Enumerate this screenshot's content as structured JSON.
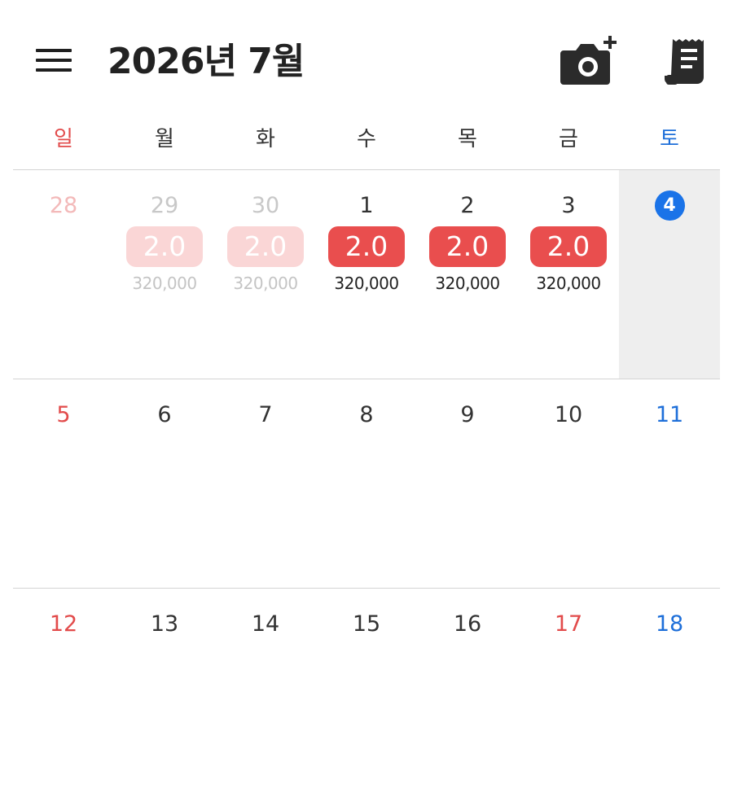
{
  "header": {
    "title": "2026년 7월",
    "icons": {
      "menu": "hamburger-menu-icon",
      "camera": "camera-add-icon",
      "receipt": "receipt-icon"
    }
  },
  "colors": {
    "sunday": "#e24b4b",
    "saturday": "#1e6fd9",
    "badge": "#e94e4e",
    "badge_faded": "#fad6d6",
    "today": "#1a73e8"
  },
  "weekdays": [
    "일",
    "월",
    "화",
    "수",
    "목",
    "금",
    "토"
  ],
  "weeks": [
    [
      {
        "date": "28",
        "other": true
      },
      {
        "date": "29",
        "other": true,
        "badge": "2.0",
        "amount": "320,000"
      },
      {
        "date": "30",
        "other": true,
        "badge": "2.0",
        "amount": "320,000"
      },
      {
        "date": "1",
        "badge": "2.0",
        "amount": "320,000"
      },
      {
        "date": "2",
        "badge": "2.0",
        "amount": "320,000"
      },
      {
        "date": "3",
        "badge": "2.0",
        "amount": "320,000"
      },
      {
        "date": "4",
        "today": true
      }
    ],
    [
      {
        "date": "5"
      },
      {
        "date": "6"
      },
      {
        "date": "7"
      },
      {
        "date": "8"
      },
      {
        "date": "9"
      },
      {
        "date": "10"
      },
      {
        "date": "11"
      }
    ],
    [
      {
        "date": "12"
      },
      {
        "date": "13"
      },
      {
        "date": "14"
      },
      {
        "date": "15"
      },
      {
        "date": "16"
      },
      {
        "date": "17",
        "holiday": true
      },
      {
        "date": "18"
      }
    ]
  ]
}
